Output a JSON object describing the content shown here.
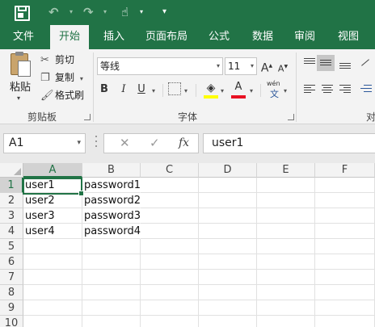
{
  "quick_access": {
    "save_icon": "save-icon",
    "undo_icon": "undo-icon",
    "redo_icon": "redo-icon",
    "touch_mode_icon": "touch-mode-icon",
    "customize_icon": "customize-toolbar-icon"
  },
  "ribbon_tabs": [
    {
      "label": "文件"
    },
    {
      "label": "开始",
      "active": true
    },
    {
      "label": "插入"
    },
    {
      "label": "页面布局"
    },
    {
      "label": "公式"
    },
    {
      "label": "数据"
    },
    {
      "label": "审阅"
    },
    {
      "label": "视图"
    }
  ],
  "clipboard": {
    "paste_label": "粘贴",
    "cut_label": "剪切",
    "copy_label": "复制",
    "format_painter_label": "格式刷",
    "group_label": "剪贴板"
  },
  "font": {
    "font_name": "等线",
    "font_size": "11",
    "grow_label": "A",
    "shrink_label": "A",
    "bold_label": "B",
    "italic_label": "I",
    "underline_label": "U",
    "font_color_label": "A",
    "phonetic_label": "wén",
    "phonetic_sub": "文",
    "group_label": "字体",
    "fill_color": "#ffff00",
    "font_color": "#e81123"
  },
  "alignment": {
    "group_label": "对"
  },
  "formula_bar": {
    "name_box": "A1",
    "cancel_glyph": "✕",
    "enter_glyph": "✓",
    "fx_label": "fx",
    "content": "user1"
  },
  "grid": {
    "columns": [
      "A",
      "B",
      "C",
      "D",
      "E",
      "F"
    ],
    "rows": [
      "1",
      "2",
      "3",
      "4",
      "5",
      "6",
      "7",
      "8",
      "9",
      "10"
    ],
    "cells": [
      [
        "user1",
        "password1"
      ],
      [
        "user2",
        "password2"
      ],
      [
        "user3",
        "password3"
      ],
      [
        "user4",
        "password4"
      ]
    ],
    "active_cell": "A1"
  },
  "colors": {
    "brand": "#217346",
    "ribbon_bg": "#f3f3f3",
    "header_selected": "#d2d2d2"
  }
}
